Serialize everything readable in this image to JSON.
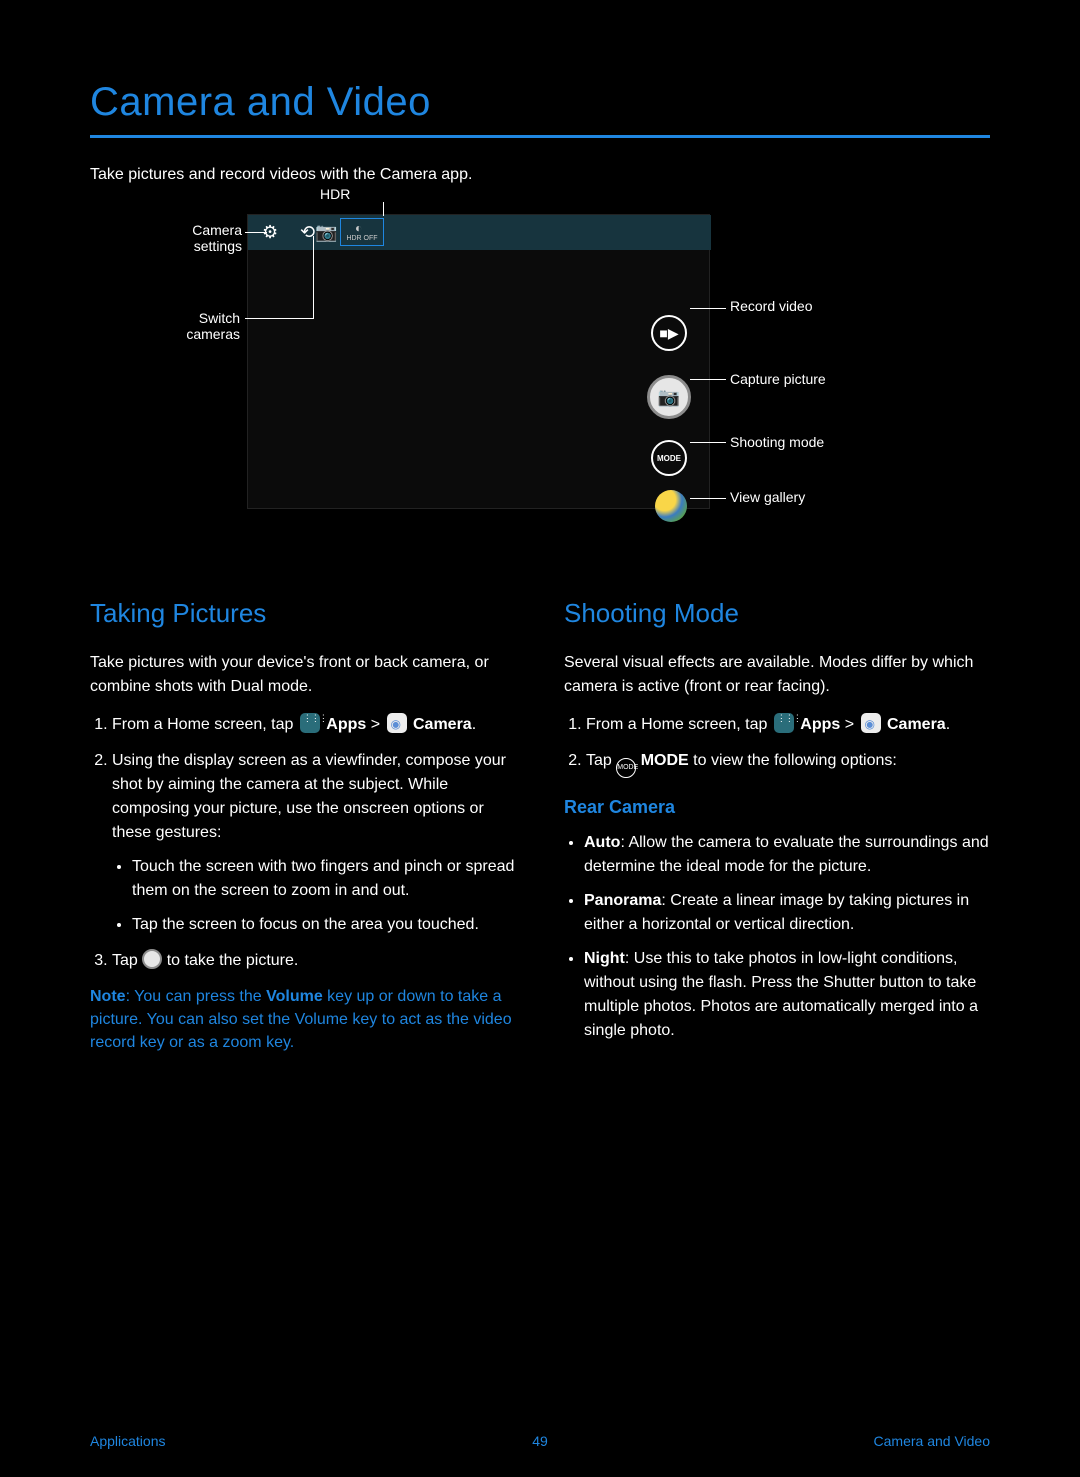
{
  "title": "Camera and Video",
  "intro": "Take pictures and record videos with the Camera app.",
  "diagram": {
    "labels": {
      "settings": "Camera settings",
      "hdr": "HDR",
      "switch": "Switch cameras",
      "record": "Record video",
      "capture": "Capture picture",
      "mode": "Shooting mode",
      "gallery": "View gallery"
    },
    "hdr_text": "HDR OFF",
    "mode_btn": "MODE"
  },
  "left": {
    "h2": "Taking Pictures",
    "lead": "Take pictures with your device's front or back camera, or combine shots with Dual mode.",
    "step1a": "From a Home screen, tap ",
    "apps": "Apps",
    "step1b": " > ",
    "camera": "Camera",
    "step1c": ".",
    "step2": "Using the display screen as a viewfinder, compose your shot by aiming the camera at the subject. While composing your picture, use the onscreen options or these gestures:",
    "b1": "Touch the screen with two fingers and pinch or spread them on the screen to zoom in and out.",
    "b2": "Tap the screen to focus on the area you touched.",
    "step3a": "Tap ",
    "step3b": " to take the picture.",
    "note_b": "Note",
    "note": ": You can press the ",
    "vol": "Volume",
    "note_end": " key up or down to take a picture. You can also set the Volume key to act as the video record key or as a zoom key."
  },
  "right": {
    "h2": "Shooting Mode",
    "lead": "Several visual effects are available. Modes differ by which camera is active (front or rear facing).",
    "step1a": "From a Home screen, tap ",
    "step1b": " > ",
    "step1c": ".",
    "step2a": "Tap ",
    "mode": "MODE",
    "step2b": " to view the following options:",
    "h3": "Rear Camera",
    "auto_b": "Auto",
    "auto": ": Allow the camera to evaluate the surroundings and determine the ideal mode for the picture.",
    "pan_b": "Panorama",
    "pan": ": Create a linear image by taking pictures in either a horizontal or vertical direction.",
    "night_b": "Night",
    "night": ": Use this to take photos in low-light conditions, without using the flash. Press the Shutter button to take multiple photos. Photos are automatically merged into a single photo."
  },
  "footer": {
    "left": "Applications",
    "page": "49",
    "right": "Camera and Video"
  }
}
